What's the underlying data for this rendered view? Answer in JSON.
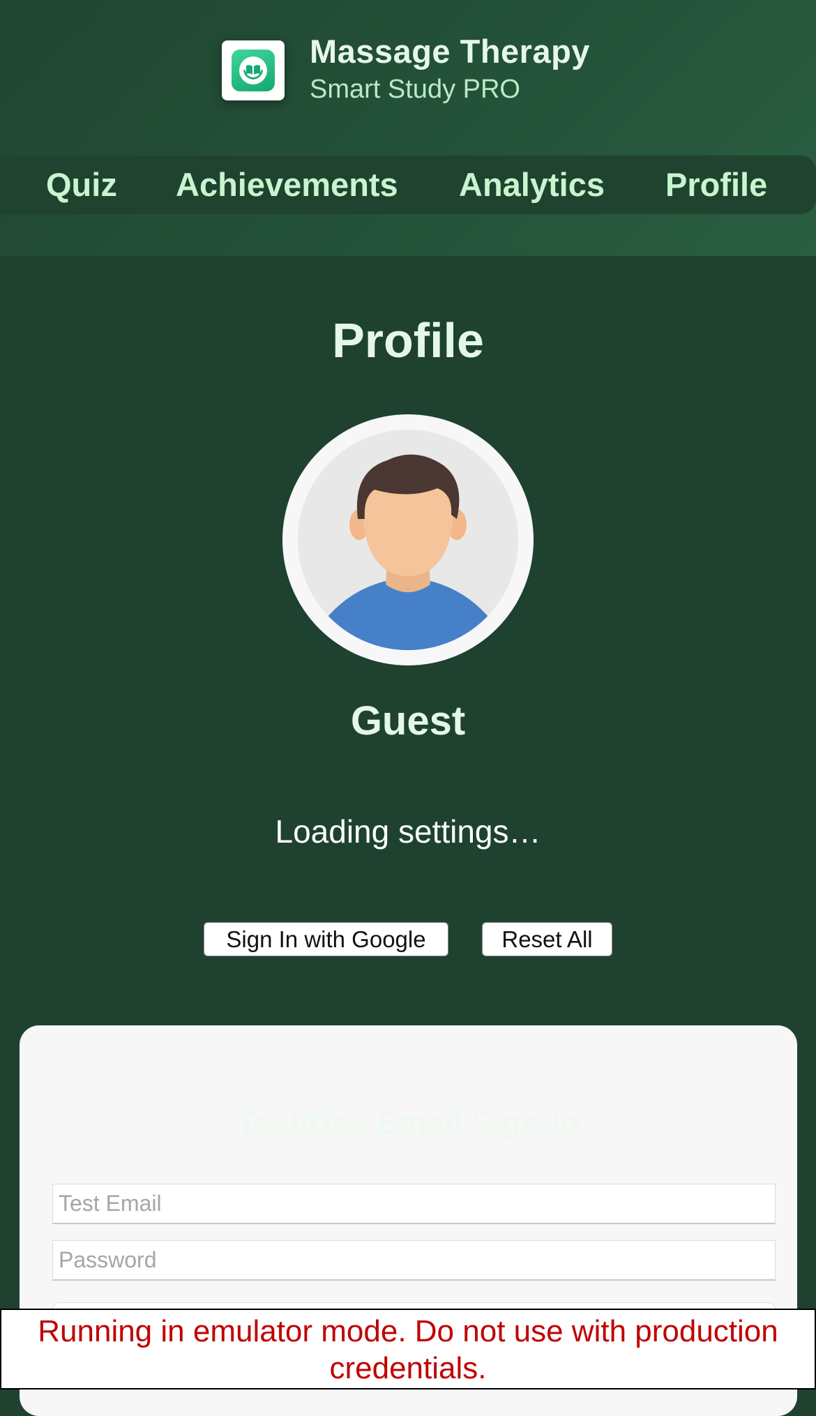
{
  "app": {
    "title": "Massage Therapy",
    "subtitle": "Smart Study PRO",
    "logo_icon": "hands-holding-book-icon",
    "accent_color": "#1fbf82"
  },
  "nav": {
    "items": [
      {
        "label": "Quiz"
      },
      {
        "label": "Achievements"
      },
      {
        "label": "Analytics"
      },
      {
        "label": "Profile"
      }
    ]
  },
  "profile": {
    "page_title": "Profile",
    "avatar_icon": "user-avatar-icon",
    "username": "Guest",
    "status_text": "Loading settings…",
    "sign_in_google_label": "Sign In with Google",
    "reset_all_label": "Reset All"
  },
  "email_signin": {
    "title": "Test/Dev Email Sign-In",
    "email_placeholder": "Test Email",
    "password_placeholder": "Password"
  },
  "emulator_warning": {
    "text": "Running in emulator mode. Do not use with production credentials.",
    "color": "#c00000"
  }
}
